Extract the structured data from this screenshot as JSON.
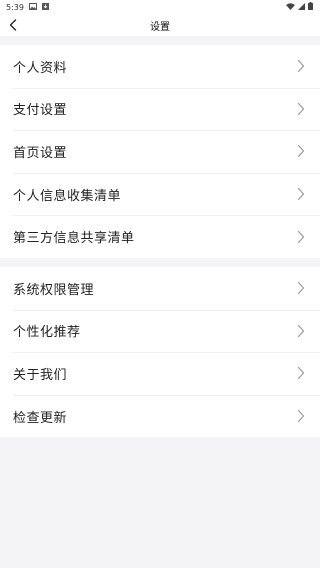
{
  "statusbar": {
    "time": "5:39"
  },
  "header": {
    "title": "设置"
  },
  "group1": [
    {
      "label": "个人资料"
    },
    {
      "label": "支付设置"
    },
    {
      "label": "首页设置"
    },
    {
      "label": "个人信息收集清单"
    },
    {
      "label": "第三方信息共享清单"
    }
  ],
  "group2": [
    {
      "label": "系统权限管理"
    },
    {
      "label": "个性化推荐"
    },
    {
      "label": "关于我们"
    },
    {
      "label": "检查更新"
    }
  ],
  "icons": {
    "back": "chevron-left-icon",
    "row_arrow": "chevron-right-icon",
    "status": [
      "image-icon",
      "download-icon",
      "wifi-icon",
      "signal-icon",
      "battery-icon"
    ]
  }
}
